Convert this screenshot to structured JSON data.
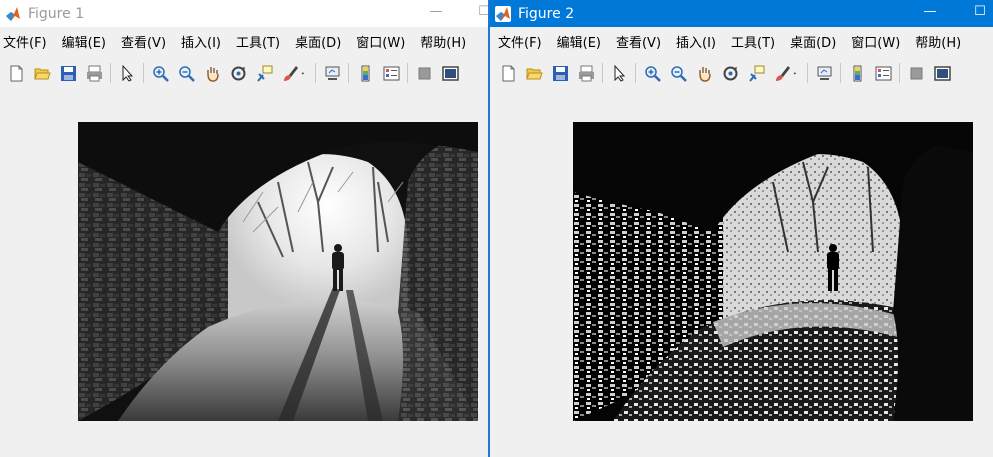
{
  "menu_items": [
    "文件(F)",
    "编辑(E)",
    "查看(V)",
    "插入(I)",
    "工具(T)",
    "桌面(D)",
    "窗口(W)",
    "帮助(H)"
  ],
  "toolbar_icons": [
    "new-figure-icon",
    "open-file-icon",
    "save-icon",
    "print-icon",
    "pointer-icon",
    "zoom-in-icon",
    "zoom-out-icon",
    "pan-hand-icon",
    "rotate-3d-icon",
    "data-cursor-icon",
    "brush-icon",
    "dropdown-arrow-icon",
    "link-plot-icon",
    "colorbar-icon",
    "legend-icon",
    "hide-plot-tools-icon",
    "show-plot-tools-icon"
  ],
  "windows": [
    {
      "title": "Figure 1",
      "active": false,
      "minimize_glyph": "—",
      "maximize_glyph": "☐",
      "image": "original grayscale tunnel photo"
    },
    {
      "title": "Figure 2",
      "active": true,
      "minimize_glyph": "—",
      "maximize_glyph": "☐",
      "image": "processed tunnel photo"
    }
  ],
  "colors": {
    "active_titlebar": "#0078d7",
    "inactive_title_text": "#9a9a9a",
    "background": "#f0f0f0"
  }
}
